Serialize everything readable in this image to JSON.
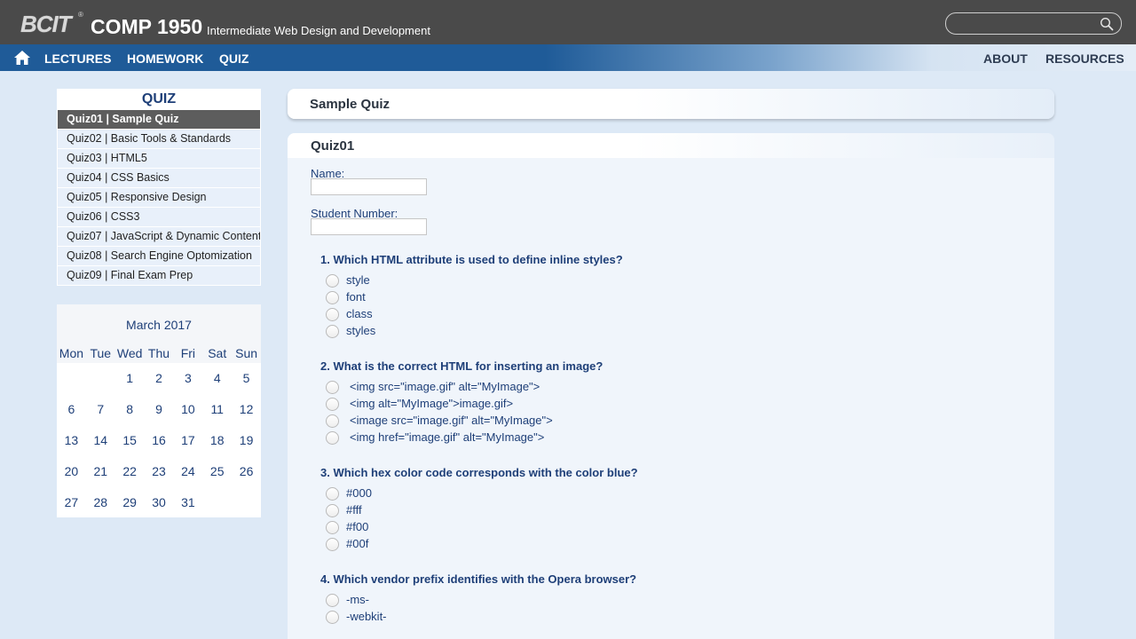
{
  "header": {
    "logo_text": "BCIT",
    "logo_mark": "®",
    "course_code": "COMP 1950",
    "course_name": "Intermediate Web Design and Development",
    "search": {
      "value": "",
      "icon": "search-icon"
    }
  },
  "nav": {
    "home_icon": "home-icon",
    "left": [
      "LECTURES",
      "HOMEWORK",
      "QUIZ"
    ],
    "right": [
      "ABOUT",
      "RESOURCES"
    ],
    "colors": {
      "bar": "#1f5b98",
      "topbar": "#4a4a4a"
    }
  },
  "sidebar": {
    "title": "QUIZ",
    "items": [
      {
        "label": "Quiz01 | Sample Quiz",
        "active": true
      },
      {
        "label": "Quiz02 | Basic Tools & Standards",
        "active": false
      },
      {
        "label": "Quiz03 | HTML5",
        "active": false
      },
      {
        "label": "Quiz04 | CSS Basics",
        "active": false
      },
      {
        "label": "Quiz05 | Responsive Design",
        "active": false
      },
      {
        "label": "Quiz06 | CSS3",
        "active": false
      },
      {
        "label": "Quiz07 | JavaScript & Dynamic Content",
        "active": false
      },
      {
        "label": "Quiz08 | Search Engine Optomization",
        "active": false
      },
      {
        "label": "Quiz09 | Final Exam Prep",
        "active": false
      }
    ]
  },
  "calendar": {
    "month": "March 2017",
    "weekdays": [
      "Mon",
      "Tue",
      "Wed",
      "Thu",
      "Fri",
      "Sat",
      "Sun"
    ],
    "weeks": [
      [
        "",
        "",
        "1",
        "2",
        "3",
        "4",
        "5"
      ],
      [
        "6",
        "7",
        "8",
        "9",
        "10",
        "11",
        "12"
      ],
      [
        "13",
        "14",
        "15",
        "16",
        "17",
        "18",
        "19"
      ],
      [
        "20",
        "21",
        "22",
        "23",
        "24",
        "25",
        "26"
      ],
      [
        "27",
        "28",
        "29",
        "30",
        "31",
        "",
        ""
      ]
    ]
  },
  "main": {
    "title": "Sample Quiz",
    "quiz_heading": "Quiz01",
    "name_label": "Name:",
    "name_value": "",
    "student_number_label": "Student Number:",
    "student_number_value": "",
    "questions": [
      {
        "text": "1. Which HTML attribute is used to define inline styles?",
        "options": [
          "style",
          "font",
          "class",
          "styles"
        ]
      },
      {
        "text": "2. What is the correct HTML for inserting an image?",
        "options": [
          "<img src=\"image.gif\" alt=\"MyImage\">",
          "<img alt=\"MyImage\">image.gif>",
          "<image src=\"image.gif\" alt=\"MyImage\">",
          "<img href=\"image.gif\" alt=\"MyImage\">"
        ]
      },
      {
        "text": "3. Which hex color code corresponds with the color blue?",
        "options": [
          "#000",
          "#fff",
          "#f00",
          "#00f"
        ]
      },
      {
        "text": "4. Which vendor prefix identifies with the Opera browser?",
        "options": [
          "-ms-",
          "-webkit-"
        ]
      }
    ]
  }
}
